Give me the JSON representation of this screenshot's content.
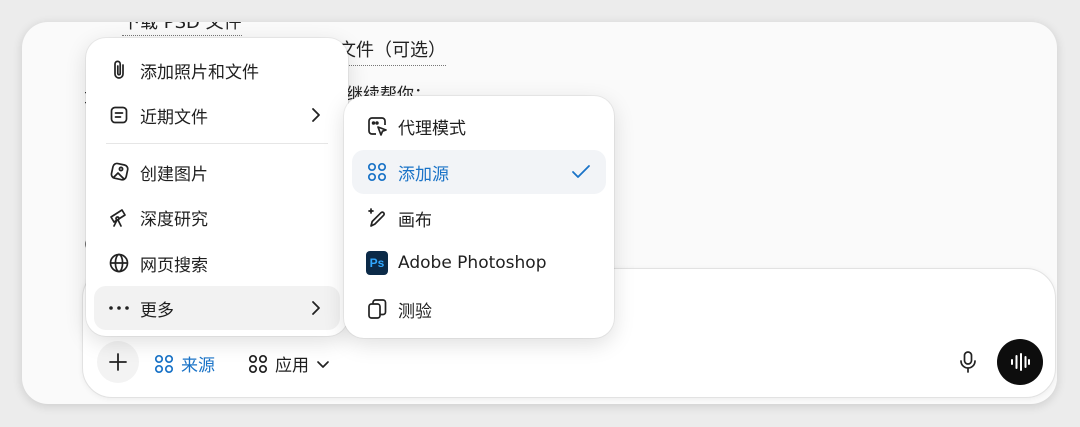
{
  "background": {
    "line_a": "下载 PSD 文件",
    "line_b": "文件（可选）",
    "line_c": "继续帮你：",
    "line_d": "或",
    "line_e": "("
  },
  "main_menu": {
    "items": [
      {
        "label": "添加照片和文件",
        "icon": "paperclip-icon"
      },
      {
        "label": "近期文件",
        "icon": "file-icon"
      },
      {
        "label": "创建图片",
        "icon": "image-create-icon"
      },
      {
        "label": "深度研究",
        "icon": "telescope-icon"
      },
      {
        "label": "网页搜索",
        "icon": "globe-icon"
      },
      {
        "label": "更多",
        "icon": "more-icon"
      }
    ]
  },
  "sub_menu": {
    "items": [
      {
        "label": "代理模式",
        "icon": "agent-icon"
      },
      {
        "label": "添加源",
        "icon": "sources-icon",
        "selected": true
      },
      {
        "label": "画布",
        "icon": "canvas-icon"
      },
      {
        "label": "Adobe Photoshop",
        "icon": "photoshop-icon",
        "badge": "Ps"
      },
      {
        "label": "测验",
        "icon": "quiz-icon"
      }
    ]
  },
  "composer": {
    "sources_label": "来源",
    "apps_label": "应用"
  },
  "colors": {
    "accent": "#1a73c7",
    "voice_button": "#0d0d0d",
    "photoshop_bg": "#0b2a48",
    "photoshop_fg": "#31a8ff"
  }
}
